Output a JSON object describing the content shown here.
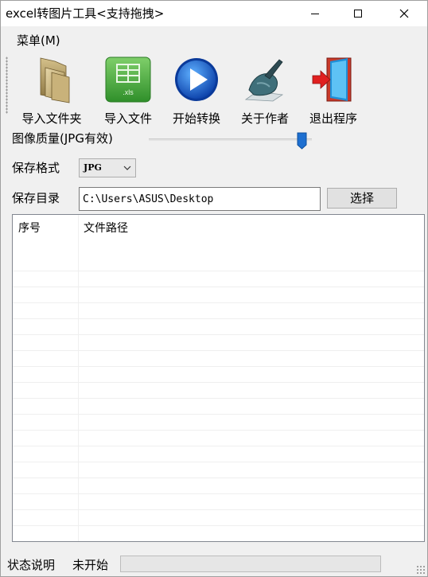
{
  "window": {
    "title": "excel转图片工具<支持拖拽>"
  },
  "menu": {
    "items": [
      {
        "label": "菜单(M)"
      }
    ]
  },
  "toolbar": {
    "buttons": [
      {
        "label": "导入文件夹",
        "icon": "folder-icon"
      },
      {
        "label": "导入文件",
        "icon": "xls-file-icon",
        "icon_text": ".xls"
      },
      {
        "label": "开始转换",
        "icon": "play-icon"
      },
      {
        "label": "关于作者",
        "icon": "writing-hand-icon"
      },
      {
        "label": "退出程序",
        "icon": "exit-door-icon"
      }
    ]
  },
  "settings": {
    "quality_label": "图像质量(JPG有效)",
    "quality_value": 0.97,
    "format_label": "保存格式",
    "format_value": "JPG",
    "dir_label": "保存目录",
    "dir_value": "C:\\Users\\ASUS\\Desktop",
    "choose_label": "选择"
  },
  "list": {
    "columns": [
      "序号",
      "文件路径"
    ],
    "rows": []
  },
  "status": {
    "label": "状态说明",
    "value": "未开始",
    "progress": 0
  },
  "colors": {
    "slider_thumb": "#1e6fd0",
    "progress_fill": "#06b025"
  }
}
